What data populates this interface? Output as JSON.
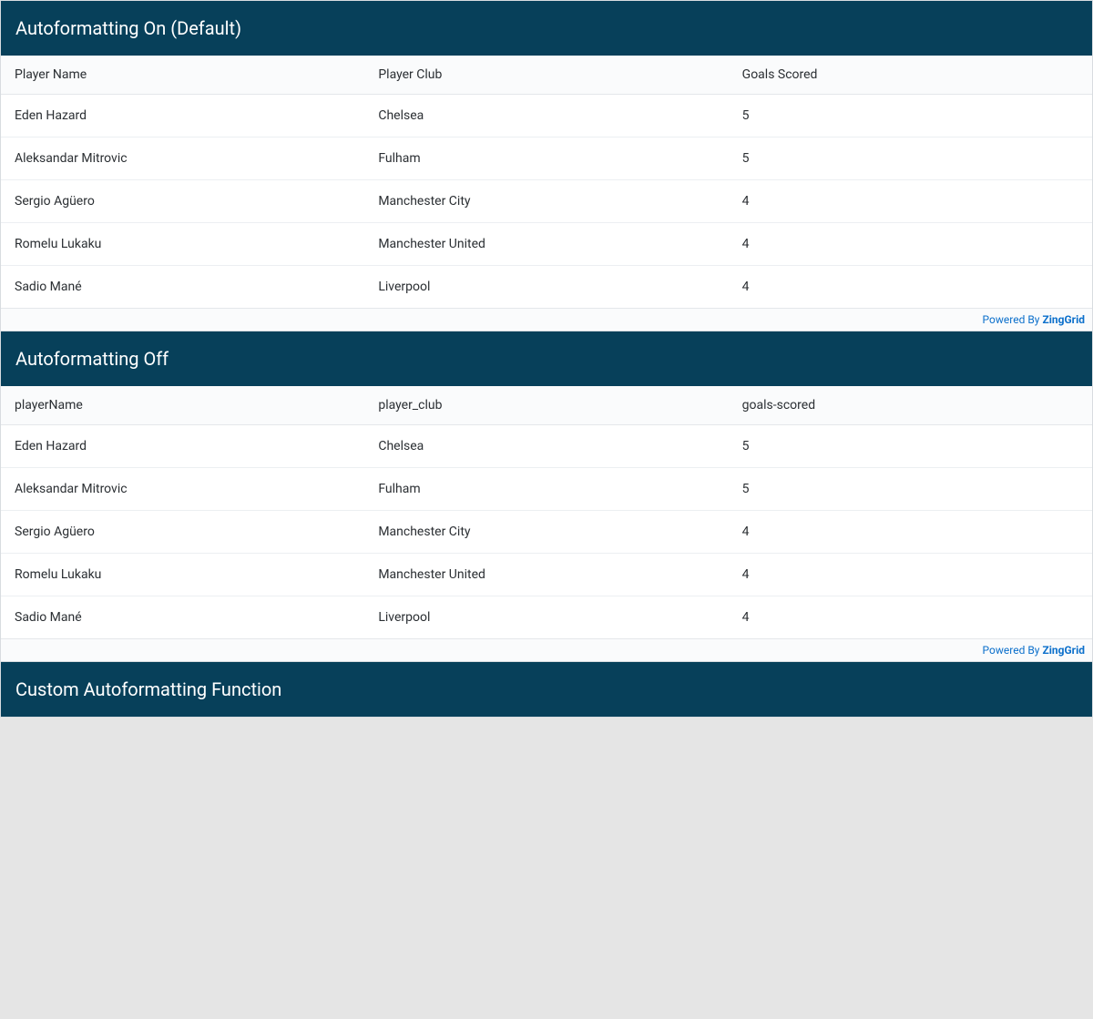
{
  "grid1": {
    "caption": "Autoformatting On (Default)",
    "headers": [
      "Player Name",
      "Player Club",
      "Goals Scored"
    ],
    "rows": [
      [
        "Eden Hazard",
        "Chelsea",
        "5"
      ],
      [
        "Aleksandar Mitrovic",
        "Fulham",
        "5"
      ],
      [
        "Sergio Agüero",
        "Manchester City",
        "4"
      ],
      [
        "Romelu Lukaku",
        "Manchester United",
        "4"
      ],
      [
        "Sadio Mané",
        "Liverpool",
        "4"
      ]
    ],
    "footer_text": "Powered By ",
    "footer_brand": "ZingGrid"
  },
  "grid2": {
    "caption": "Autoformatting Off",
    "headers": [
      "playerName",
      "player_club",
      "goals-scored"
    ],
    "rows": [
      [
        "Eden Hazard",
        "Chelsea",
        "5"
      ],
      [
        "Aleksandar Mitrovic",
        "Fulham",
        "5"
      ],
      [
        "Sergio Agüero",
        "Manchester City",
        "4"
      ],
      [
        "Romelu Lukaku",
        "Manchester United",
        "4"
      ],
      [
        "Sadio Mané",
        "Liverpool",
        "4"
      ]
    ],
    "footer_text": "Powered By ",
    "footer_brand": "ZingGrid"
  },
  "grid3": {
    "caption": "Custom Autoformatting Function"
  }
}
